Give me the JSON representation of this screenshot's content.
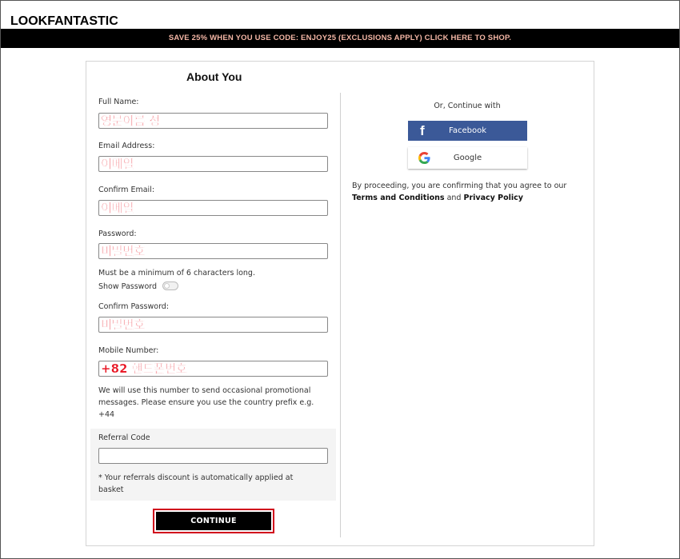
{
  "brand": {
    "logo": "LOOKFANTASTIC"
  },
  "promo": {
    "text": "SAVE 25% WHEN YOU USE CODE: ENJOY25 (EXCLUSIONS APPLY) CLICK HERE TO SHOP."
  },
  "form": {
    "title": "About You",
    "full_name": {
      "label": "Full Name:",
      "value": "영문이름 성"
    },
    "email": {
      "label": "Email Address:",
      "value": "이메일"
    },
    "confirm_email": {
      "label": "Confirm Email:",
      "value": "이메일"
    },
    "password": {
      "label": "Password:",
      "value": "비밀번호",
      "hint": "Must be a minimum of 6 characters long."
    },
    "show_password": {
      "label": "Show Password"
    },
    "confirm_password": {
      "label": "Confirm Password:",
      "value": "비밀번호"
    },
    "mobile": {
      "label": "Mobile Number:",
      "value": "+82 핸드폰번호",
      "hint_line1": "We will use this number to send occasional promotional",
      "hint_line2": "messages. Please ensure you use the country prefix e.g.",
      "hint_line3": "+44"
    },
    "referral": {
      "label": "Referral Code",
      "value": "",
      "hint_line1": "* Your referrals discount is automatically applied at",
      "hint_line2": "basket"
    },
    "continue_label": "CONTINUE"
  },
  "social": {
    "or_text": "Or, Continue with",
    "facebook_label": "Facebook",
    "google_label": "Google",
    "terms_prefix": "By proceeding, you are confirming that you agree to our",
    "terms_link": "Terms and Conditions",
    "terms_and": "and",
    "privacy_link": "Privacy Policy"
  },
  "colors": {
    "promo_bg": "#000000",
    "promo_text": "#f5b7a6",
    "facebook": "#3b5998",
    "annotation_red": "#e8101e",
    "continue_outline": "#d0021b"
  }
}
